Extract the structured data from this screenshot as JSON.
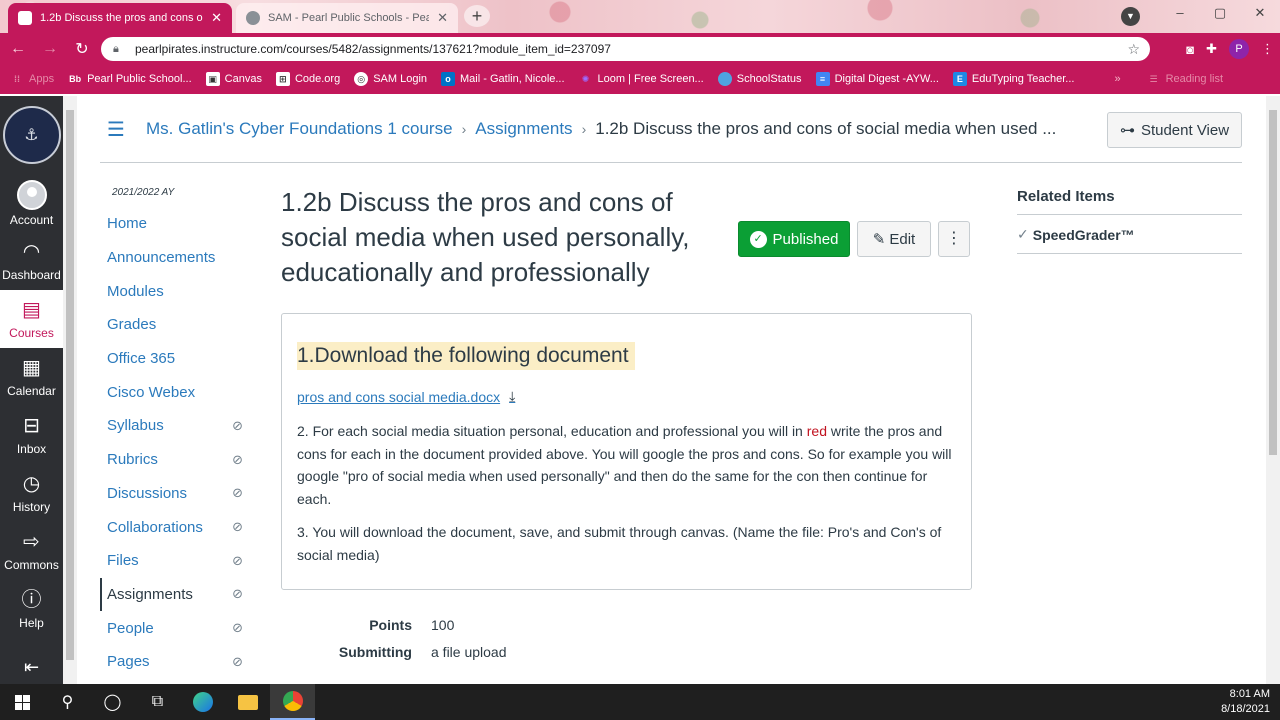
{
  "browser": {
    "tabs": [
      {
        "title": "1.2b Discuss the pros and cons o",
        "active": true
      },
      {
        "title": "SAM - Pearl Public Schools - Pea",
        "active": false
      }
    ],
    "url": "pearlpirates.instructure.com/courses/5482/assignments/137621?module_item_id=237097",
    "profile_initial": "P",
    "bookmarks": [
      {
        "label": "Apps",
        "icon": "apps-grid-icon"
      },
      {
        "label": "Pearl Public School...",
        "icon": "bb-icon"
      },
      {
        "label": "Canvas",
        "icon": "canvas-icon"
      },
      {
        "label": "Code.org",
        "icon": "codeorg-icon"
      },
      {
        "label": "SAM Login",
        "icon": "sam-icon"
      },
      {
        "label": "Mail - Gatlin, Nicole...",
        "icon": "outlook-icon"
      },
      {
        "label": "Loom | Free Screen...",
        "icon": "loom-icon"
      },
      {
        "label": "SchoolStatus",
        "icon": "schoolstatus-icon"
      },
      {
        "label": "Digital Digest -AYW...",
        "icon": "doc-icon"
      },
      {
        "label": "EduTyping Teacher...",
        "icon": "edutyping-icon"
      }
    ],
    "bookmarks_more": "»",
    "reading_list": "Reading list"
  },
  "global_nav": [
    {
      "label": "Account",
      "icon": "account-avatar-icon"
    },
    {
      "label": "Dashboard",
      "icon": "dashboard-icon"
    },
    {
      "label": "Courses",
      "icon": "courses-icon",
      "active": true
    },
    {
      "label": "Calendar",
      "icon": "calendar-icon"
    },
    {
      "label": "Inbox",
      "icon": "inbox-icon"
    },
    {
      "label": "History",
      "icon": "history-icon"
    },
    {
      "label": "Commons",
      "icon": "commons-icon"
    },
    {
      "label": "Help",
      "icon": "help-icon"
    }
  ],
  "breadcrumb": {
    "course": "Ms. Gatlin's Cyber Foundations 1 course",
    "section": "Assignments",
    "current": "1.2b Discuss the pros and cons of social media when used ..."
  },
  "student_view": "Student View",
  "course_nav": {
    "term": "2021/2022 AY",
    "items": [
      {
        "label": "Home",
        "hidden": false
      },
      {
        "label": "Announcements",
        "hidden": false
      },
      {
        "label": "Modules",
        "hidden": false
      },
      {
        "label": "Grades",
        "hidden": false
      },
      {
        "label": "Office 365",
        "hidden": false
      },
      {
        "label": "Cisco Webex",
        "hidden": false
      },
      {
        "label": "Syllabus",
        "hidden": true
      },
      {
        "label": "Rubrics",
        "hidden": true
      },
      {
        "label": "Discussions",
        "hidden": true
      },
      {
        "label": "Collaborations",
        "hidden": true
      },
      {
        "label": "Files",
        "hidden": true
      },
      {
        "label": "Assignments",
        "hidden": true,
        "active": true
      },
      {
        "label": "People",
        "hidden": true
      },
      {
        "label": "Pages",
        "hidden": true
      }
    ]
  },
  "assignment": {
    "title": "1.2b Discuss the pros and cons of social media when used personally, educationally and professionally",
    "published_label": "Published",
    "edit_label": "Edit",
    "step1": "1.Download the following document",
    "doc_link": "pros and cons social media.docx",
    "step2_a": "2. For each social media situation personal, education and professional you will in ",
    "step2_red": "red",
    "step2_b": " write the pros and cons for each in the document provided above.  You will google the pros and cons.  So for example you will google \"pro of social media when used personally\" and then do the same for the con then continue for each.",
    "step3": "3. You will download the document, save, and submit through canvas. (Name the file: Pro's and Con's of social media)",
    "points_label": "Points",
    "points_value": "100",
    "submitting_label": "Submitting",
    "submitting_value": "a file upload"
  },
  "related": {
    "heading": "Related Items",
    "speedgrader": "SpeedGrader™"
  },
  "taskbar": {
    "time": "8:01 AM",
    "date": "8/18/2021"
  },
  "colors": {
    "brand": "#c2185b",
    "link": "#2b7abc",
    "published": "#0b9f35",
    "highlight": "#fbeec6"
  }
}
